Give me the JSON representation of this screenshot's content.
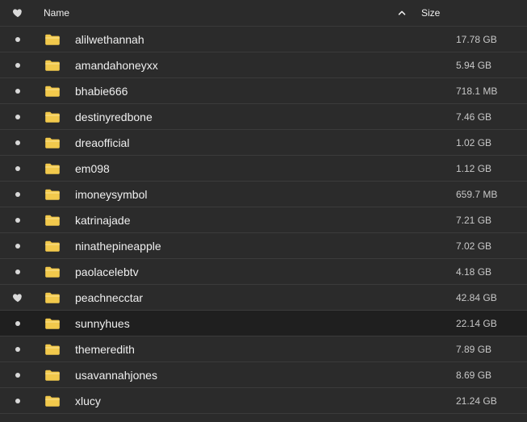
{
  "header": {
    "fav_icon": "heart-icon",
    "name_label": "Name",
    "sort_icon": "chevron-up-icon",
    "size_label": "Size"
  },
  "colors": {
    "background": "#2b2b2b",
    "selected_row": "#1f1f1f",
    "folder": "#f2c94c",
    "heart": "#d9d9d9"
  },
  "rows": [
    {
      "name": "alilwethannah",
      "size": "17.78 GB",
      "favorite": false
    },
    {
      "name": "amandahoneyxx",
      "size": "5.94 GB",
      "favorite": false
    },
    {
      "name": "bhabie666",
      "size": "718.1 MB",
      "favorite": false
    },
    {
      "name": "destinyredbone",
      "size": "7.46 GB",
      "favorite": false
    },
    {
      "name": "dreaofficial",
      "size": "1.02 GB",
      "favorite": false
    },
    {
      "name": "em098",
      "size": "1.12 GB",
      "favorite": false
    },
    {
      "name": "imoneysymbol",
      "size": "659.7 MB",
      "favorite": false
    },
    {
      "name": "katrinajade",
      "size": "7.21 GB",
      "favorite": false
    },
    {
      "name": "ninathepineapple",
      "size": "7.02 GB",
      "favorite": false
    },
    {
      "name": "paolacelebtv",
      "size": "4.18 GB",
      "favorite": false
    },
    {
      "name": "peachnecctar",
      "size": "42.84 GB",
      "favorite": true
    },
    {
      "name": "sunnyhues",
      "size": "22.14 GB",
      "favorite": false,
      "selected": true
    },
    {
      "name": "themeredith",
      "size": "7.89 GB",
      "favorite": false
    },
    {
      "name": "usavannahjones",
      "size": "8.69 GB",
      "favorite": false
    },
    {
      "name": "xlucy",
      "size": "21.24 GB",
      "favorite": false
    }
  ]
}
